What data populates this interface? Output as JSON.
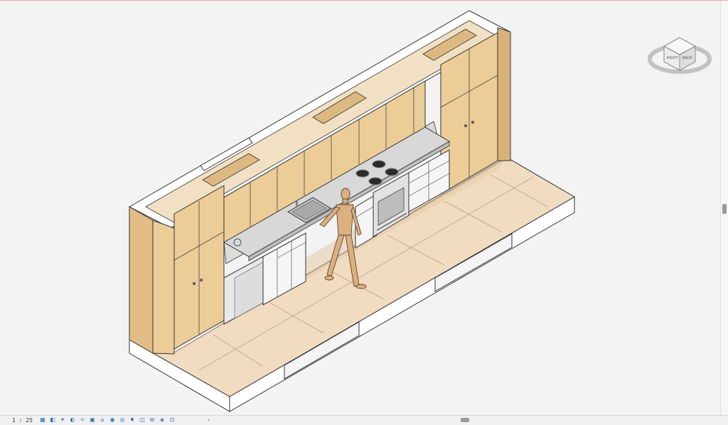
{
  "view": {
    "scale_label": "1 : 25"
  },
  "viewcube": {
    "face_right": "RIGHT",
    "face_back": "BACK"
  },
  "statusbar": {
    "icons": [
      "detail-level-icon",
      "visual-style-icon",
      "sun-path-icon",
      "shadows-icon",
      "crop-view-icon",
      "show-crop-icon",
      "unlock-3d-icon",
      "temporary-hide-icon",
      "reveal-hidden-icon",
      "lightbulb-icon",
      "worksharing-icon",
      "analytical-icon",
      "highlight-icon",
      "constraints-icon"
    ],
    "glyphs": [
      "▦",
      "◧",
      "✶",
      "◐",
      "⌗",
      "▣",
      "⌂",
      "◉",
      "◎",
      "♦",
      "◫",
      "⧉",
      "◈",
      "⊡"
    ]
  },
  "colors": {
    "wood": "#eccd98",
    "wood_dark": "#d8b27a",
    "floor": "#f0dcc4",
    "slab": "#ffffff",
    "counter": "#d9d9d9",
    "appliance": "#ececec",
    "background": "#f3f3f3"
  }
}
